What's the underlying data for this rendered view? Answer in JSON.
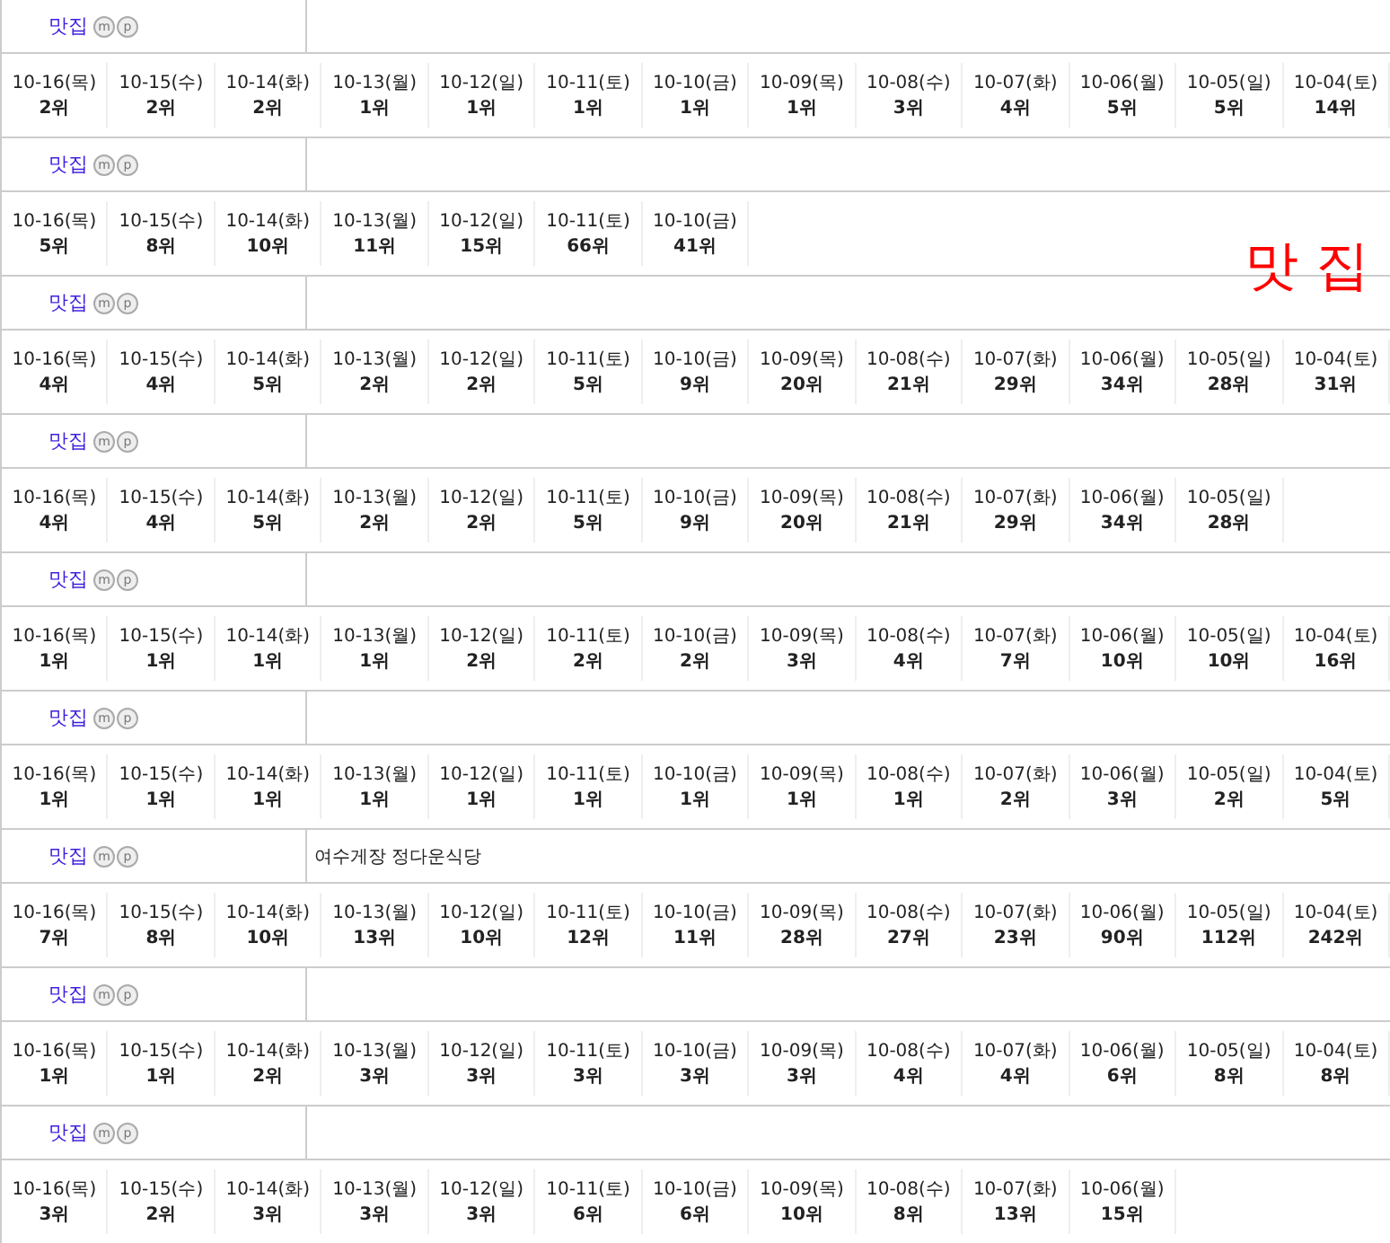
{
  "blocks": [
    {
      "keyword": "맛집",
      "badges": [
        "m",
        "p"
      ],
      "days": [
        {
          "date": "10-16(목)",
          "rank": "2위"
        },
        {
          "date": "10-15(수)",
          "rank": "2위"
        },
        {
          "date": "10-14(화)",
          "rank": "2위"
        },
        {
          "date": "10-13(월)",
          "rank": "1위"
        },
        {
          "date": "10-12(일)",
          "rank": "1위"
        },
        {
          "date": "10-11(토)",
          "rank": "1위"
        },
        {
          "date": "10-10(금)",
          "rank": "1위"
        },
        {
          "date": "10-09(목)",
          "rank": "1위"
        },
        {
          "date": "10-08(수)",
          "rank": "3위"
        },
        {
          "date": "10-07(화)",
          "rank": "4위"
        },
        {
          "date": "10-06(월)",
          "rank": "5위"
        },
        {
          "date": "10-05(일)",
          "rank": "5위"
        },
        {
          "date": "10-04(토)",
          "rank": "14위"
        }
      ]
    },
    {
      "keyword": "맛집",
      "badges": [
        "m",
        "p"
      ],
      "days": [
        {
          "date": "10-16(목)",
          "rank": "5위"
        },
        {
          "date": "10-15(수)",
          "rank": "8위"
        },
        {
          "date": "10-14(화)",
          "rank": "10위"
        },
        {
          "date": "10-13(월)",
          "rank": "11위"
        },
        {
          "date": "10-12(일)",
          "rank": "15위"
        },
        {
          "date": "10-11(토)",
          "rank": "66위"
        },
        {
          "date": "10-10(금)",
          "rank": "41위"
        }
      ]
    },
    {
      "keyword": "맛집",
      "badges": [
        "m",
        "p"
      ],
      "days": [
        {
          "date": "10-16(목)",
          "rank": "4위"
        },
        {
          "date": "10-15(수)",
          "rank": "4위"
        },
        {
          "date": "10-14(화)",
          "rank": "5위"
        },
        {
          "date": "10-13(월)",
          "rank": "2위"
        },
        {
          "date": "10-12(일)",
          "rank": "2위"
        },
        {
          "date": "10-11(토)",
          "rank": "5위"
        },
        {
          "date": "10-10(금)",
          "rank": "9위"
        },
        {
          "date": "10-09(목)",
          "rank": "20위"
        },
        {
          "date": "10-08(수)",
          "rank": "21위"
        },
        {
          "date": "10-07(화)",
          "rank": "29위"
        },
        {
          "date": "10-06(월)",
          "rank": "34위"
        },
        {
          "date": "10-05(일)",
          "rank": "28위"
        },
        {
          "date": "10-04(토)",
          "rank": "31위"
        }
      ]
    },
    {
      "keyword": "맛집",
      "badges": [
        "m",
        "p"
      ],
      "days": [
        {
          "date": "10-16(목)",
          "rank": "4위"
        },
        {
          "date": "10-15(수)",
          "rank": "4위"
        },
        {
          "date": "10-14(화)",
          "rank": "5위"
        },
        {
          "date": "10-13(월)",
          "rank": "2위"
        },
        {
          "date": "10-12(일)",
          "rank": "2위"
        },
        {
          "date": "10-11(토)",
          "rank": "5위"
        },
        {
          "date": "10-10(금)",
          "rank": "9위"
        },
        {
          "date": "10-09(목)",
          "rank": "20위"
        },
        {
          "date": "10-08(수)",
          "rank": "21위"
        },
        {
          "date": "10-07(화)",
          "rank": "29위"
        },
        {
          "date": "10-06(월)",
          "rank": "34위"
        },
        {
          "date": "10-05(일)",
          "rank": "28위"
        }
      ]
    },
    {
      "keyword": "맛집",
      "badges": [
        "m",
        "p"
      ],
      "days": [
        {
          "date": "10-16(목)",
          "rank": "1위"
        },
        {
          "date": "10-15(수)",
          "rank": "1위"
        },
        {
          "date": "10-14(화)",
          "rank": "1위"
        },
        {
          "date": "10-13(월)",
          "rank": "1위"
        },
        {
          "date": "10-12(일)",
          "rank": "2위"
        },
        {
          "date": "10-11(토)",
          "rank": "2위"
        },
        {
          "date": "10-10(금)",
          "rank": "2위"
        },
        {
          "date": "10-09(목)",
          "rank": "3위"
        },
        {
          "date": "10-08(수)",
          "rank": "4위"
        },
        {
          "date": "10-07(화)",
          "rank": "7위"
        },
        {
          "date": "10-06(월)",
          "rank": "10위"
        },
        {
          "date": "10-05(일)",
          "rank": "10위"
        },
        {
          "date": "10-04(토)",
          "rank": "16위"
        }
      ]
    },
    {
      "keyword": "맛집",
      "badges": [
        "m",
        "p"
      ],
      "days": [
        {
          "date": "10-16(목)",
          "rank": "1위"
        },
        {
          "date": "10-15(수)",
          "rank": "1위"
        },
        {
          "date": "10-14(화)",
          "rank": "1위"
        },
        {
          "date": "10-13(월)",
          "rank": "1위"
        },
        {
          "date": "10-12(일)",
          "rank": "1위"
        },
        {
          "date": "10-11(토)",
          "rank": "1위"
        },
        {
          "date": "10-10(금)",
          "rank": "1위"
        },
        {
          "date": "10-09(목)",
          "rank": "1위"
        },
        {
          "date": "10-08(수)",
          "rank": "1위"
        },
        {
          "date": "10-07(화)",
          "rank": "2위"
        },
        {
          "date": "10-06(월)",
          "rank": "3위"
        },
        {
          "date": "10-05(일)",
          "rank": "2위"
        },
        {
          "date": "10-04(토)",
          "rank": "5위"
        }
      ]
    },
    {
      "keyword": "맛집",
      "badges": [
        "m",
        "p"
      ],
      "name": "여수게장 정다운식당",
      "days": [
        {
          "date": "10-16(목)",
          "rank": "7위"
        },
        {
          "date": "10-15(수)",
          "rank": "8위"
        },
        {
          "date": "10-14(화)",
          "rank": "10위"
        },
        {
          "date": "10-13(월)",
          "rank": "13위"
        },
        {
          "date": "10-12(일)",
          "rank": "10위"
        },
        {
          "date": "10-11(토)",
          "rank": "12위"
        },
        {
          "date": "10-10(금)",
          "rank": "11위"
        },
        {
          "date": "10-09(목)",
          "rank": "28위"
        },
        {
          "date": "10-08(수)",
          "rank": "27위"
        },
        {
          "date": "10-07(화)",
          "rank": "23위"
        },
        {
          "date": "10-06(월)",
          "rank": "90위"
        },
        {
          "date": "10-05(일)",
          "rank": "112위"
        },
        {
          "date": "10-04(토)",
          "rank": "242위"
        }
      ]
    },
    {
      "keyword": "맛집",
      "badges": [
        "m",
        "p"
      ],
      "days": [
        {
          "date": "10-16(목)",
          "rank": "1위"
        },
        {
          "date": "10-15(수)",
          "rank": "1위"
        },
        {
          "date": "10-14(화)",
          "rank": "2위"
        },
        {
          "date": "10-13(월)",
          "rank": "3위"
        },
        {
          "date": "10-12(일)",
          "rank": "3위"
        },
        {
          "date": "10-11(토)",
          "rank": "3위"
        },
        {
          "date": "10-10(금)",
          "rank": "3위"
        },
        {
          "date": "10-09(목)",
          "rank": "3위"
        },
        {
          "date": "10-08(수)",
          "rank": "4위"
        },
        {
          "date": "10-07(화)",
          "rank": "4위"
        },
        {
          "date": "10-06(월)",
          "rank": "6위"
        },
        {
          "date": "10-05(일)",
          "rank": "8위"
        },
        {
          "date": "10-04(토)",
          "rank": "8위"
        }
      ]
    },
    {
      "keyword": "맛집",
      "badges": [
        "m",
        "p"
      ],
      "days": [
        {
          "date": "10-16(목)",
          "rank": "3위"
        },
        {
          "date": "10-15(수)",
          "rank": "2위"
        },
        {
          "date": "10-14(화)",
          "rank": "3위"
        },
        {
          "date": "10-13(월)",
          "rank": "3위"
        },
        {
          "date": "10-12(일)",
          "rank": "3위"
        },
        {
          "date": "10-11(토)",
          "rank": "6위"
        },
        {
          "date": "10-10(금)",
          "rank": "6위"
        },
        {
          "date": "10-09(목)",
          "rank": "10위"
        },
        {
          "date": "10-08(수)",
          "rank": "8위"
        },
        {
          "date": "10-07(화)",
          "rank": "13위"
        },
        {
          "date": "10-06(월)",
          "rank": "15위"
        }
      ]
    }
  ],
  "overlay_label": "맛 집"
}
